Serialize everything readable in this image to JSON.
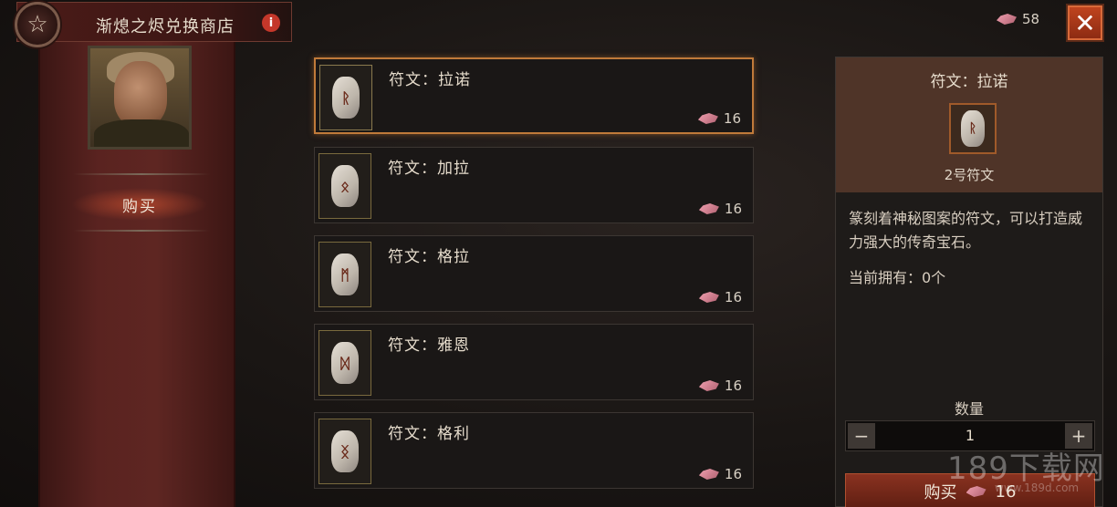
{
  "header": {
    "title": "渐熄之烬兑换商店",
    "info_label": "i",
    "emblem_icon": "pentagram-icon",
    "currency_icon": "ember-shard-icon",
    "currency_amount": "58",
    "close_label": "✕"
  },
  "sidebar": {
    "npc_portrait": "vendor-portrait",
    "tab_buy": "购买"
  },
  "items": [
    {
      "name": "符文：拉诺",
      "price": "16",
      "glyph": "ᚱ",
      "selected": true
    },
    {
      "name": "符文：加拉",
      "price": "16",
      "glyph": "ᛟ",
      "selected": false
    },
    {
      "name": "符文：格拉",
      "price": "16",
      "glyph": "ᛗ",
      "selected": false
    },
    {
      "name": "符文：雅恩",
      "price": "16",
      "glyph": "ᛞ",
      "selected": false
    },
    {
      "name": "符文：格利",
      "price": "16",
      "glyph": "ᛝ",
      "selected": false
    }
  ],
  "detail": {
    "title": "符文：拉诺",
    "subtitle": "2号符文",
    "glyph": "ᚱ",
    "description": "篆刻着神秘图案的符文，可以打造威力强大的传奇宝石。",
    "owned": "当前拥有：0个",
    "quantity_label": "数量",
    "quantity": "1",
    "minus_label": "−",
    "plus_label": "+",
    "buy_label": "购买",
    "buy_price": "16"
  },
  "watermark": {
    "text": "189下载网",
    "sub": "www.189d.com"
  },
  "colors": {
    "accent": "#c07a3a",
    "banner": "#5a2320",
    "close": "#c2451f"
  }
}
